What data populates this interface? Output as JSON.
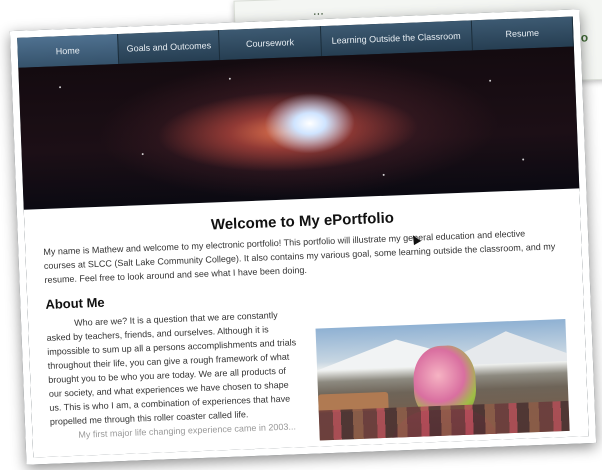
{
  "background_page": {
    "text": "...",
    "side_text": "ul\no"
  },
  "nav": {
    "items": [
      {
        "label": "Home",
        "active": true
      },
      {
        "label": "Goals and Outcomes",
        "active": false
      },
      {
        "label": "Coursework",
        "active": false
      },
      {
        "label": "Learning Outside the Classroom",
        "active": false
      },
      {
        "label": "Resume",
        "active": false
      }
    ]
  },
  "main": {
    "title": "Welcome to My ePortfolio",
    "intro": "My name is Mathew        and welcome to my electronic portfolio! This portfolio will illustrate my general education and elective courses at SLCC (Salt Lake Community College). It also contains my various goal, some learning outside the classroom, and my resume. Feel free to look around and see what I have been doing.",
    "about_title": "About Me",
    "about_text": "Who are we? It is a question that we are constantly asked by teachers, friends, and ourselves. Although it is impossible to sum up all a persons accomplishments and trials throughout their life, you can give a rough framework of what brought you to be who you are today. We are all products of our society, and what experiences we have chosen to shape us. This is who I am, a combination of experiences that have propelled me through this roller coaster called life.",
    "about_text_cut": "My first major life changing experience came in 2003..."
  }
}
